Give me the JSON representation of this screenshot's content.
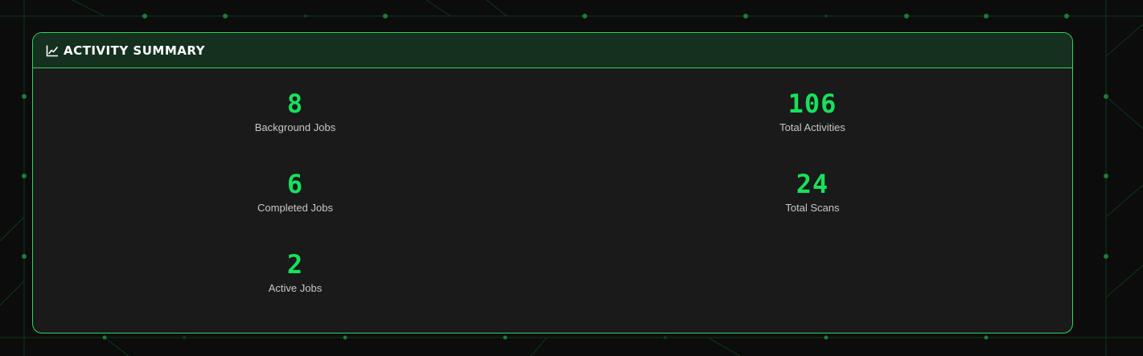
{
  "panel": {
    "title": "Activity Summary",
    "icon": "chart-line-icon",
    "accent_color": "#18e05c",
    "border_color": "#2fd35c"
  },
  "stats": {
    "background_jobs": {
      "value": "8",
      "label": "Background Jobs"
    },
    "completed_jobs": {
      "value": "6",
      "label": "Completed Jobs"
    },
    "active_jobs": {
      "value": "2",
      "label": "Active Jobs"
    },
    "total_activities": {
      "value": "106",
      "label": "Total Activities"
    },
    "total_scans": {
      "value": "24",
      "label": "Total Scans"
    }
  }
}
